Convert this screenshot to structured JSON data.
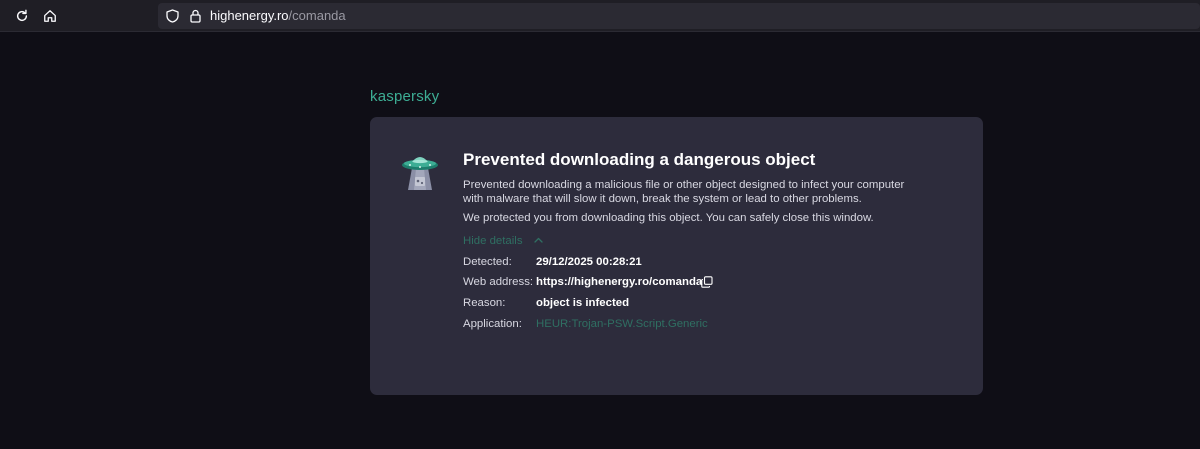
{
  "browser": {
    "url_host": "highenergy.ro",
    "url_path": "/comanda"
  },
  "brand": {
    "name": "kaspersky",
    "color": "#3dad94"
  },
  "alert": {
    "title": "Prevented downloading a dangerous object",
    "description": "Prevented downloading a malicious file or other object designed to infect your computer with malware that will slow it down, break the system or lead to other problems.",
    "reassurance": "We protected you from downloading this object. You can safely close this window.",
    "toggle_label": "Hide details",
    "details": [
      {
        "label": "Detected:",
        "value": "29/12/2025 00:28:21"
      },
      {
        "label": "Web address:",
        "value": "https://highenergy.ro/comanda"
      },
      {
        "label": "Reason:",
        "value": "object is infected"
      },
      {
        "label": "Application:",
        "value": "HEUR:Trojan-PSW.Script.Generic"
      }
    ]
  },
  "icons": {
    "reload": "reload-icon",
    "home": "home-icon",
    "tracking_protection": "shield-icon",
    "secure": "lock-icon",
    "illustration": "ufo-icon",
    "toggle": "chevron-up-icon",
    "copy": "copy-icon"
  }
}
